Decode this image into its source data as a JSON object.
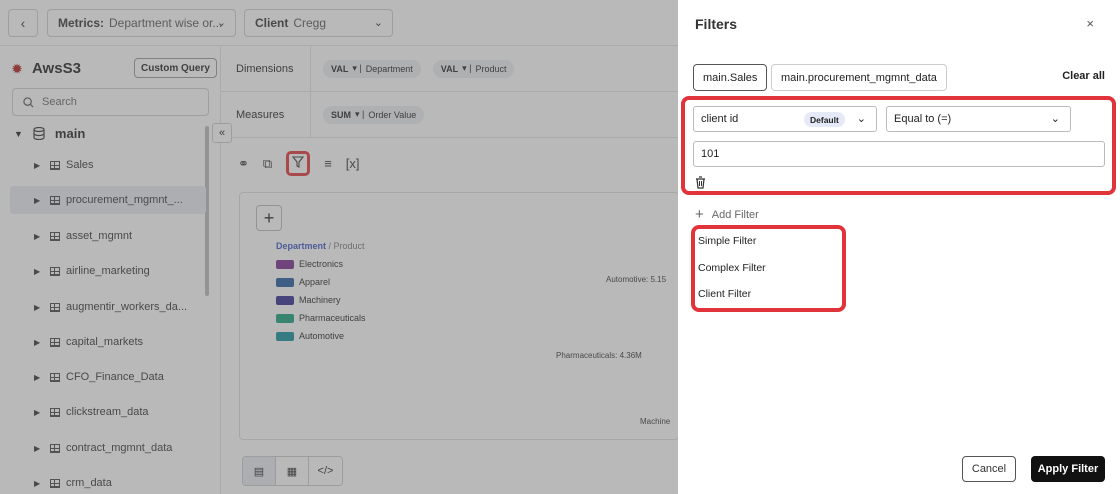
{
  "topbar": {
    "metrics_label": "Metrics:",
    "metrics_value": "Department wise or...",
    "client_label": "Client",
    "client_value": "Cregg"
  },
  "sidebar": {
    "title": "AwsS3",
    "custom_query": "Custom Query",
    "search_placeholder": "Search",
    "root": "main",
    "items": [
      {
        "label": "Sales"
      },
      {
        "label": "procurement_mgmnt_..."
      },
      {
        "label": "asset_mgmnt"
      },
      {
        "label": "airline_marketing"
      },
      {
        "label": "augmentir_workers_da..."
      },
      {
        "label": "capital_markets"
      },
      {
        "label": "CFO_Finance_Data"
      },
      {
        "label": "clickstream_data"
      },
      {
        "label": "contract_mgmnt_data"
      },
      {
        "label": "crm_data"
      }
    ]
  },
  "builder": {
    "dimensions_label": "Dimensions",
    "measures_label": "Measures",
    "dimensions": [
      {
        "agg": "VAL",
        "field": "Department"
      },
      {
        "agg": "VAL",
        "field": "Product"
      }
    ],
    "measures": [
      {
        "agg": "SUM",
        "field": "Order Value"
      }
    ]
  },
  "chart": {
    "legend_title_primary": "Department",
    "legend_title_secondary": "/ Product",
    "legend": [
      {
        "label": "Electronics",
        "color": "#7a2a8c"
      },
      {
        "label": "Apparel",
        "color": "#1f5a9e"
      },
      {
        "label": "Machinery",
        "color": "#2e2a8c"
      },
      {
        "label": "Pharmaceuticals",
        "color": "#13a07a"
      },
      {
        "label": "Automotive",
        "color": "#0f8f9a"
      }
    ],
    "annotations": [
      "Automotive: 5.15",
      "Pharmaceuticals: 4.36M",
      "Machine"
    ]
  },
  "filters": {
    "title": "Filters",
    "tabs": [
      "main.Sales",
      "main.procurement_mgmnt_data"
    ],
    "clear_all": "Clear all",
    "field_value": "client id",
    "field_badge": "Default",
    "operator_value": "Equal to (=)",
    "input_value": "101",
    "add_filter": "Add Filter",
    "menu": [
      "Simple Filter",
      "Complex Filter",
      "Client Filter"
    ],
    "cancel": "Cancel",
    "apply": "Apply Filter"
  },
  "colors": {
    "highlight": "#e0333a",
    "apply_bg": "#111111"
  }
}
